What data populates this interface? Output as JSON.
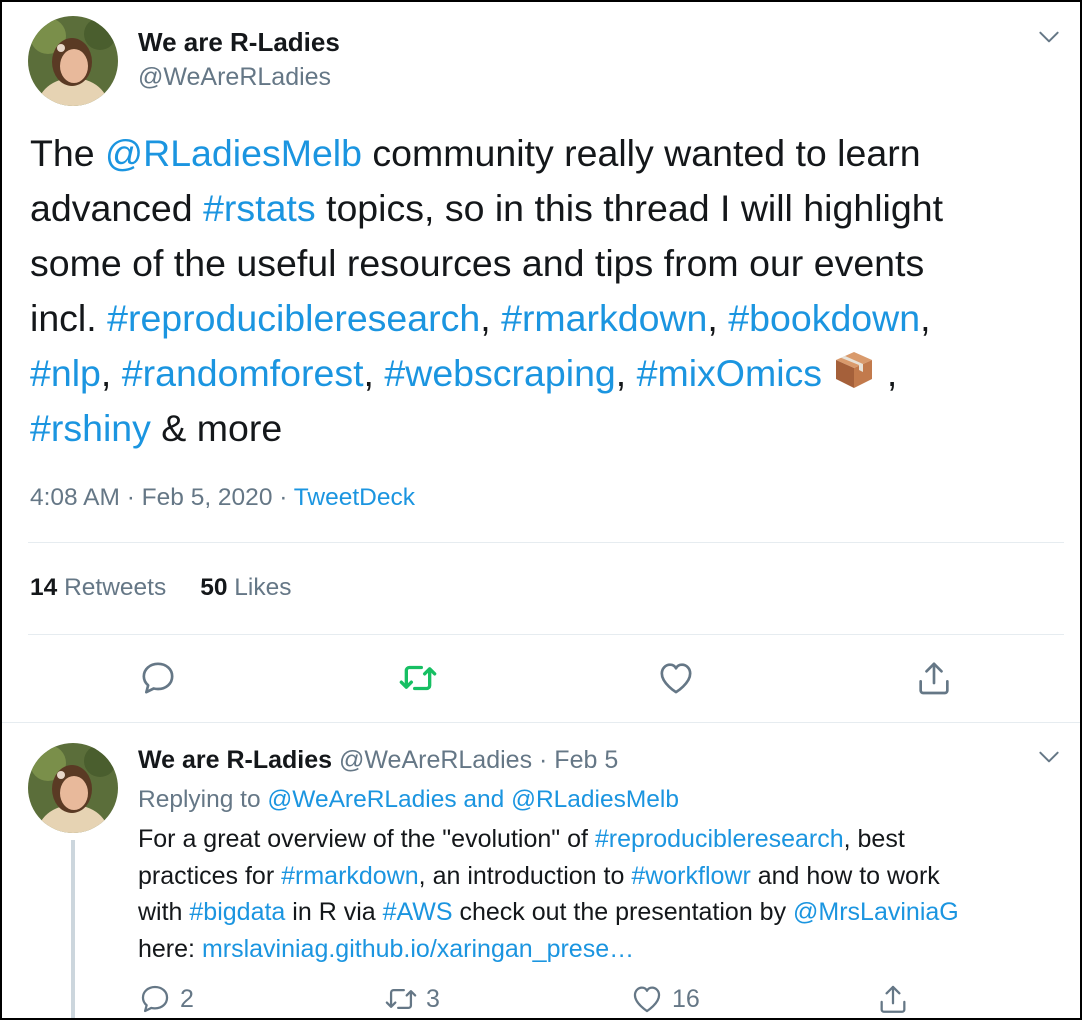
{
  "main_tweet": {
    "author_name": "We are R-Ladies",
    "author_handle": "@WeAreRLadies",
    "text": {
      "l1_a": "The ",
      "l1_mention": "@RLadiesMelb",
      "l1_b": " community really wanted to learn",
      "l2_a": "advanced ",
      "l2_tag": "#rstats",
      "l2_b": " topics, so in this thread I will highlight",
      "l3": "some of the useful resources and tips from our events",
      "l4_a": "incl. ",
      "l4_tag1": "#reproducibleresearch",
      "l4_sep1": ", ",
      "l4_tag2": "#rmarkdown",
      "l4_sep2": ", ",
      "l4_tag3": "#bookdown",
      "l4_sep3": ",",
      "l5_tag1": "#nlp",
      "l5_sep1": ",  ",
      "l5_tag2": "#randomforest",
      "l5_sep2": ", ",
      "l5_tag3": "#webscraping",
      "l5_sep3": ", ",
      "l5_tag4": "#mixOmics",
      "l5_sep4": " ,",
      "l6_tag": "#rshiny",
      "l6_b": " & more"
    },
    "time": "4:08 AM",
    "dot1": " · ",
    "date": "Feb 5, 2020",
    "dot2": " · ",
    "source": "TweetDeck",
    "retweets_count": "14",
    "retweets_label": "Retweets",
    "likes_count": "50",
    "likes_label": "Likes"
  },
  "reply_tweet": {
    "author_name": "We are R-Ladies",
    "author_handle": "@WeAreRLadies",
    "dot": " · ",
    "date": "Feb 5",
    "replying_prefix": "Replying to ",
    "replying_user1": "@WeAreRLadies",
    "replying_and": " and ",
    "replying_user2": "@RLadiesMelb",
    "text": {
      "l1_a": "For a great overview of the \"evolution\" of ",
      "l1_tag": "#reproducibleresearch",
      "l1_b": ", best",
      "l2_a": "practices for ",
      "l2_tag1": "#rmarkdown",
      "l2_b": ", an introduction to ",
      "l2_tag2": "#workflowr",
      "l2_c": " and how to work",
      "l3_a": "with ",
      "l3_tag1": "#bigdata",
      "l3_b": " in R via ",
      "l3_tag2": "#AWS",
      "l3_c": " check out the presentation by ",
      "l3_mention": "@MrsLaviniaG",
      "l4_a": "here: ",
      "l4_link": "mrslaviniag.github.io/xaringan_prese…"
    },
    "reply_count": "2",
    "retweet_count": "3",
    "like_count": "16"
  },
  "colors": {
    "link": "#1b95e0",
    "muted": "#657786",
    "retweeted_green": "#17bf63",
    "divider": "#e6ecf0"
  },
  "icons": {
    "caret": "chevron-down-icon",
    "reply": "reply-icon",
    "retweet": "retweet-icon",
    "like": "heart-icon",
    "share": "share-icon",
    "emoji": "package-emoji"
  }
}
